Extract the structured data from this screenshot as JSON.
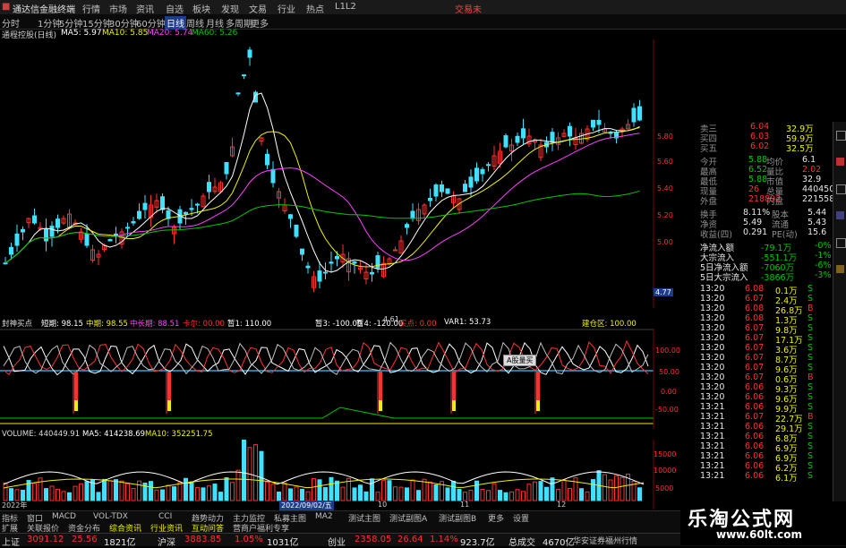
{
  "titlebar": {
    "app_title": "通达信金融终端",
    "menus": [
      "行情",
      "市场",
      "资讯",
      "自选",
      "板块",
      "发现",
      "文易",
      "行业",
      "热点",
      "L1L2"
    ],
    "right_label": "交易未"
  },
  "periods": [
    "分时",
    "1分钟",
    "5分钟",
    "15分钟",
    "30分钟",
    "60分钟",
    "日线",
    "周线",
    "月线",
    "多周期",
    "更多"
  ],
  "ma_legend": {
    "name": "通程控股(日线)",
    "ma5": "MA5: 5.97",
    "ma10": "MA10: 5.85",
    "ma20": "MA20: 5.74",
    "ma60": "MA60: 5.26"
  },
  "colors": {
    "up": "#ff3030",
    "down": "#40e0ff",
    "ma5": "#ffffff",
    "ma10": "#f0f000",
    "ma20": "#ff40ff",
    "ma60": "#00c800"
  },
  "price_axis": [
    "5.80",
    "5.60",
    "5.40",
    "5.20",
    "5.00",
    "4.80"
  ],
  "chart_annotations": {
    "low": "4.61",
    "current": "4.77"
  },
  "indicator": {
    "name": "封神买点",
    "f1": "短期: 98.15",
    "f2": "中期: 98.55",
    "f3": "中长期: 88.51",
    "f4": "卡尔: 00.00",
    "f5": "暂1: 110.00",
    "f6": "暂3: -100.00",
    "f7": "暂4: -120.00",
    "f8": "买点: 0.00",
    "f9": "VAR1: 53.73",
    "f10": "建仓区: 100.00",
    "axis": [
      "100.00",
      "50.00",
      "0.00",
      "-50.00",
      "-100.00"
    ],
    "tooltip": "A股量买"
  },
  "volume": {
    "name": "VOLUME: 440449.91",
    "ma5": "MA5: 414238.69",
    "ma10": "MA10: 352251.75",
    "axis": [
      "15000",
      "10000",
      "5000"
    ],
    "date_left": "2022年",
    "date_mid": "2022/09/02/五",
    "month_10": "10",
    "month_11": "11",
    "month_12": "12"
  },
  "quote": {
    "top": [
      {
        "label": "卖三",
        "price": "6.04",
        "vol": "32.9万"
      },
      {
        "label": "买四",
        "price": "6.03",
        "vol": "59.9万"
      },
      {
        "label": "买五",
        "price": "6.02",
        "vol": "32.5万"
      }
    ],
    "stats": [
      {
        "l1": "今开",
        "v1": "5.88",
        "l2": "均价",
        "v2": "6.1"
      },
      {
        "l1": "最高",
        "v1": "6.52",
        "l2": "量比",
        "v2": "2.02"
      },
      {
        "l1": "最低",
        "v1": "5.88",
        "l2": "市值",
        "v2": "32.9"
      },
      {
        "l1": "现量",
        "v1": "26",
        "l2": "总量",
        "v2": "440450"
      },
      {
        "l1": "外盘",
        "v1": "218892",
        "l2": "内盘",
        "v2": "221558"
      }
    ],
    "stats2": [
      {
        "l1": "换手",
        "v1": "8.11%",
        "l2": "股本",
        "v2": "5.44"
      },
      {
        "l1": "净资",
        "v1": "5.49",
        "l2": "流通",
        "v2": "5.43"
      },
      {
        "l1": "收益(四)",
        "v1": "0.291",
        "l2": "PE(动)",
        "v2": "15.6"
      }
    ],
    "flows": [
      {
        "label": "净流入额",
        "value": "-79.1万",
        "pct": "-0%"
      },
      {
        "label": "大宗流入",
        "value": "-551.1万",
        "pct": "-1%"
      },
      {
        "label": "5日净流入额",
        "value": "-7060万",
        "pct": "-6%"
      },
      {
        "label": "5日大宗流入",
        "value": "-3866万",
        "pct": "-3%"
      }
    ],
    "ticks": [
      {
        "t": "13:20",
        "p": "6.08",
        "v": "0.1万",
        "d": "S"
      },
      {
        "t": "13:20",
        "p": "6.07",
        "v": "2.4万",
        "d": "S"
      },
      {
        "t": "13:20",
        "p": "6.08",
        "v": "26.8万",
        "d": "B"
      },
      {
        "t": "13:20",
        "p": "6.08",
        "v": "1.3万",
        "d": "S"
      },
      {
        "t": "13:20",
        "p": "6.07",
        "v": "9.8万",
        "d": "S"
      },
      {
        "t": "13:20",
        "p": "6.07",
        "v": "17.1万",
        "d": "S"
      },
      {
        "t": "13:20",
        "p": "6.07",
        "v": "3.6万",
        "d": "S"
      },
      {
        "t": "13:20",
        "p": "6.07",
        "v": "8.7万",
        "d": "S"
      },
      {
        "t": "13:20",
        "p": "6.07",
        "v": "9.6万",
        "d": "S"
      },
      {
        "t": "13:20",
        "p": "6.07",
        "v": "0.6万",
        "d": "B"
      },
      {
        "t": "13:20",
        "p": "6.06",
        "v": "9.3万",
        "d": "S"
      },
      {
        "t": "13:20",
        "p": "6.06",
        "v": "9.6万",
        "d": "S"
      },
      {
        "t": "13:21",
        "p": "6.06",
        "v": "9.9万",
        "d": "S"
      },
      {
        "t": "13:21",
        "p": "6.07",
        "v": "22.7万",
        "d": "B"
      },
      {
        "t": "13:21",
        "p": "6.06",
        "v": "29.1万",
        "d": "S"
      },
      {
        "t": "13:21",
        "p": "6.06",
        "v": "6.8万",
        "d": "S"
      },
      {
        "t": "13:21",
        "p": "6.06",
        "v": "6.9万",
        "d": "S"
      },
      {
        "t": "13:21",
        "p": "6.06",
        "v": "6.9万",
        "d": "S"
      },
      {
        "t": "13:21",
        "p": "6.06",
        "v": "6.2万",
        "d": "S"
      },
      {
        "t": "13:21",
        "p": "6.06",
        "v": "6.1万",
        "d": "S"
      }
    ]
  },
  "tabs_row1": [
    "指标",
    "窗口",
    "MACD",
    "VOL-TDX",
    "CCI",
    "趋势动力",
    "主力监控",
    "私募主图",
    "MA2",
    "测试主图",
    "测试副图A",
    "测试副图B",
    "更多",
    "设置"
  ],
  "tabs_row2": [
    "扩展",
    "关联报价",
    "资金分布",
    "综合资讯",
    "行业资讯",
    "互动问答",
    "营商户福利专享"
  ],
  "status": {
    "sh_label": "上证",
    "sh_idx": "3091.12",
    "sh_chg": "25.56",
    "sh_amt": "1821亿",
    "hs_label": "沪深",
    "hs_idx": "3883.85",
    "hs_pct": "1.05%",
    "hs_amt": "1031亿",
    "cy_label": "创业",
    "cy_idx": "2358.05",
    "cy_chg": "26.64",
    "cy_pct": "1.14%",
    "cy_amt": "923.7亿",
    "total_label": "总成交",
    "total_amt": "4670亿",
    "broker": "华安证券福州行情"
  },
  "watermark": {
    "title": "乐淘公式网",
    "url": "www.60lt.com"
  }
}
